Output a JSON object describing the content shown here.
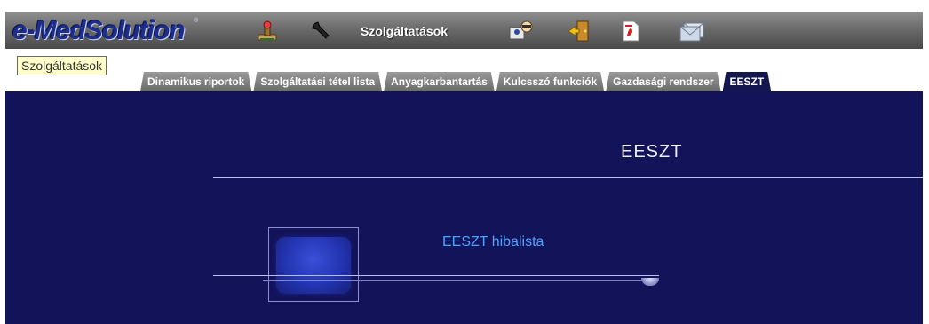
{
  "app": {
    "logo_text": "e-MedSolution",
    "logo_mark": "®"
  },
  "toolbar": {
    "icons": [
      {
        "name": "stamp-icon"
      },
      {
        "name": "wrench-icon"
      },
      {
        "name": "user-card-icon"
      },
      {
        "name": "exit-door-icon"
      },
      {
        "name": "pdf-icon"
      },
      {
        "name": "mail-icon"
      }
    ],
    "service_label": "Szolgáltatások"
  },
  "breadcrumb": {
    "label": "Szolgáltatások"
  },
  "tabs": [
    {
      "label": "Dinamikus riportok",
      "active": false
    },
    {
      "label": "Szolgáltatási tétel lista",
      "active": false
    },
    {
      "label": "Anyagkarbantartás",
      "active": false
    },
    {
      "label": "Kulcsszó funkciók",
      "active": false
    },
    {
      "label": "Gazdasági rendszer",
      "active": false
    },
    {
      "label": "EESZT",
      "active": true
    }
  ],
  "main": {
    "section_title": "EESZT",
    "items": [
      {
        "label": "EESZT hibalista"
      }
    ]
  },
  "colors": {
    "panel_bg": "#13135a",
    "active_tab": "#14164f",
    "link": "#4fa3ff",
    "breadcrumb_bg": "#ffffcc"
  }
}
